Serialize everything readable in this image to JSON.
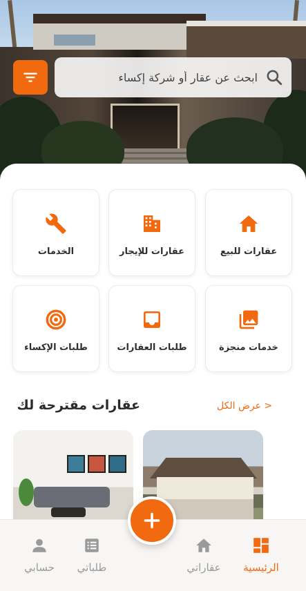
{
  "colors": {
    "accent": "#f16a10",
    "inactive": "#9a9a9a"
  },
  "search": {
    "placeholder": "ابحث عن عقار أو شركة إكساء"
  },
  "categories": [
    {
      "label": "عقارات للبيع",
      "icon": "home-icon"
    },
    {
      "label": "عقارات للإيجار",
      "icon": "building-icon"
    },
    {
      "label": "الخدمات",
      "icon": "wrench-icon"
    },
    {
      "label": "خدمات منجزة",
      "icon": "image-gallery-icon"
    },
    {
      "label": "طلبات العقارات",
      "icon": "inbox-icon"
    },
    {
      "label": "طلبات الإكساء",
      "icon": "target-icon"
    }
  ],
  "suggested": {
    "title": "عقارات مقترحة لك",
    "view_all": "< عرض الكل"
  },
  "nav": {
    "home": "الرئيسية",
    "my_properties": "عقاراتي",
    "my_requests": "طلباتي",
    "account": "حسابي"
  }
}
